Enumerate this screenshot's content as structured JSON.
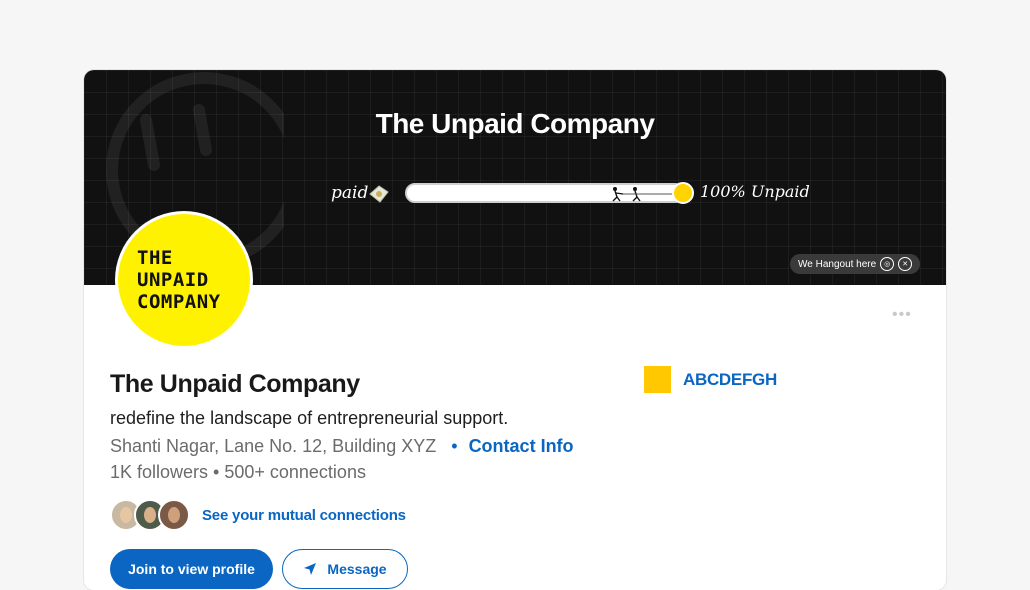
{
  "banner": {
    "title": "The Unpaid Company",
    "scale_left": "paid",
    "scale_right": "100% Unpaid",
    "progress_fraction": 1.0,
    "hangout_label": "We Hangout here",
    "social_icons": [
      "instagram-icon",
      "x-icon"
    ]
  },
  "logo": {
    "lines": [
      "THE",
      "UNPAID",
      "COMPANY"
    ],
    "color": "#fff200"
  },
  "profile": {
    "name": "The Unpaid Company",
    "headline": "redefine the landscape of entrepreneurial support.",
    "location": "Shanti Nagar, Lane No. 12, Building XYZ",
    "contact_info": "Contact Info",
    "followers": "1K followers • 500+ connections",
    "mutual_label": "See your mutual connections",
    "mutual_avatars": 3
  },
  "company": {
    "name": "ABCDEFGH",
    "color": "#ffc800"
  },
  "actions": {
    "join": "Join to view profile",
    "message": "Message"
  },
  "colors": {
    "accent": "#0a66c2",
    "banner_bg": "#111111",
    "knob": "#ffd400"
  }
}
